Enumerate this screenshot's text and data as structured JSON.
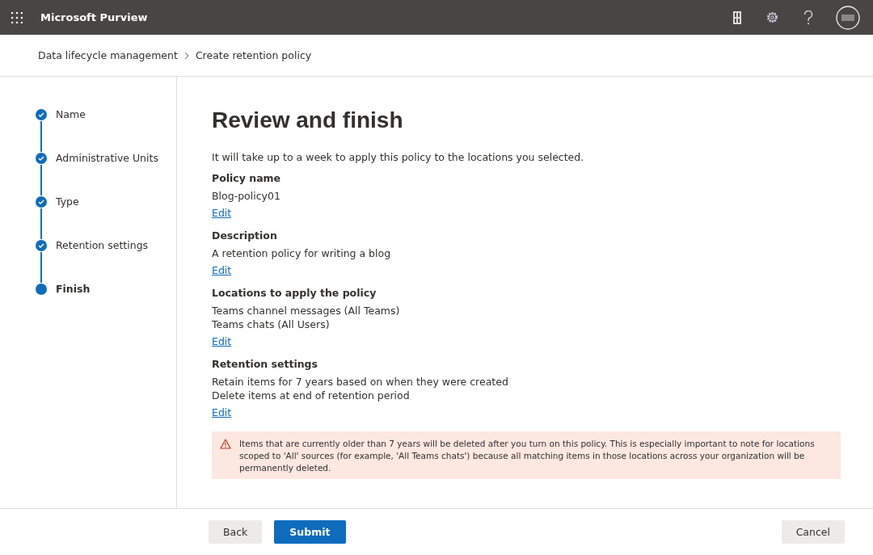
{
  "app_title": "Microsoft Purview",
  "breadcrumb": [
    {
      "label": "Data lifecycle management"
    },
    {
      "label": "Create retention policy"
    }
  ],
  "steps": [
    {
      "label": "Name",
      "completed": true,
      "selected": false
    },
    {
      "label": "Administrative Units",
      "completed": true,
      "selected": false
    },
    {
      "label": "Type",
      "completed": true,
      "selected": false
    },
    {
      "label": "Retention settings",
      "completed": true,
      "selected": false
    },
    {
      "label": "Finish",
      "completed": false,
      "selected": true
    }
  ],
  "page_title": "Review and finish",
  "intro": "It will take up to a week to apply this policy to the locations you selected.",
  "sections": [
    {
      "heading": "Policy name",
      "lines": [
        "Blog-policy01"
      ],
      "edit": "Edit"
    },
    {
      "heading": "Description",
      "lines": [
        "A retention policy for writing a blog"
      ],
      "edit": "Edit"
    },
    {
      "heading": "Locations to apply the policy",
      "lines": [
        "Teams channel messages (All Teams)",
        "Teams chats (All Users)"
      ],
      "edit": "Edit"
    },
    {
      "heading": "Retention settings",
      "lines": [
        "Retain items for 7 years based on when they were created",
        "Delete items at end of retention period"
      ],
      "edit": "Edit"
    }
  ],
  "warning": "Items that are currently older than 7 years will be deleted after you turn on this policy. This is especially important to note for locations scoped to 'All' sources (for example, 'All Teams chats') because all matching items in those locations across your organization will be permanently deleted.",
  "footer": {
    "back": "Back",
    "submit": "Submit",
    "cancel": "Cancel"
  }
}
